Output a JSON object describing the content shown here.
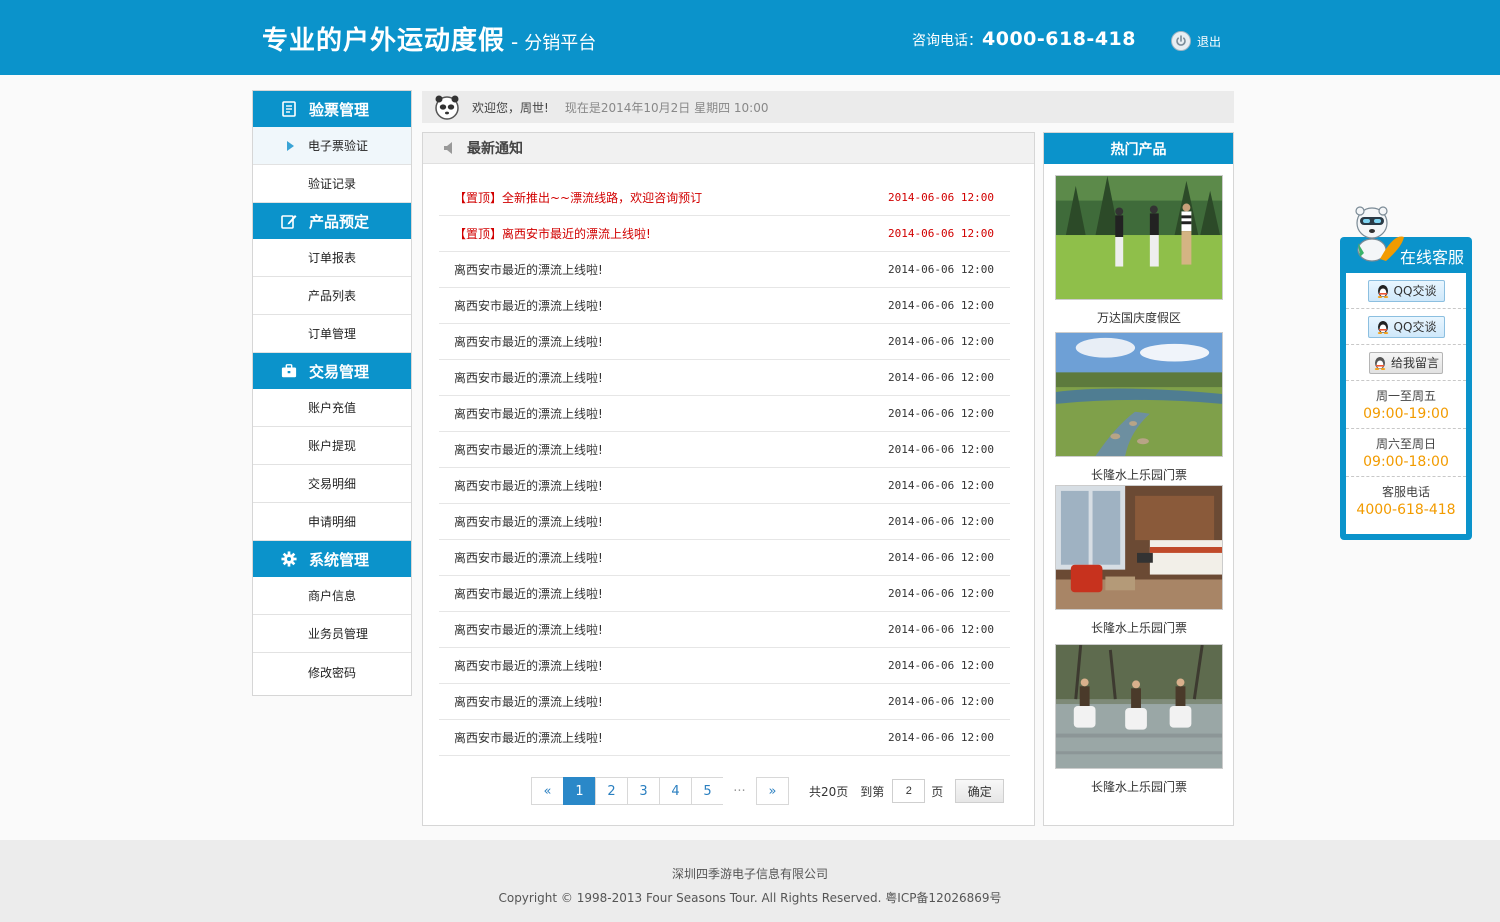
{
  "header": {
    "logo_main": "专业的户外运动度假",
    "logo_sep": "-",
    "logo_sub": "分销平台",
    "hotline_label": "咨询电话：",
    "hotline_number": "4000-618-418",
    "logout_label": "退出",
    "logout_icon": "power-icon"
  },
  "sidebar": {
    "groups": [
      {
        "title": "验票管理",
        "icon": "ticket-icon",
        "items": [
          "电子票验证",
          "验证记录"
        ]
      },
      {
        "title": "产品预定",
        "icon": "edit-icon",
        "items": [
          "订单报表",
          "产品列表",
          "订单管理"
        ]
      },
      {
        "title": "交易管理",
        "icon": "briefcase-icon",
        "items": [
          "账户充值",
          "账户提现",
          "交易明细",
          "申请明细"
        ]
      },
      {
        "title": "系统管理",
        "icon": "gear-icon",
        "items": [
          "商户信息",
          "业务员管理",
          "修改密码"
        ]
      }
    ],
    "active_item": "电子票验证"
  },
  "welcome": {
    "greeting": "欢迎您，周世!",
    "date_text": "现在是2014年10月2日 星期四 10:00"
  },
  "notice": {
    "title": "最新通知",
    "rows": [
      {
        "title": "【置顶】全新推出~~漂流线路，欢迎咨询预订",
        "date": "2014-06-06 12:00",
        "pinned": true
      },
      {
        "title": "【置顶】离西安市最近的漂流上线啦!",
        "date": "2014-06-06 12:00",
        "pinned": true
      },
      {
        "title": "离西安市最近的漂流上线啦!",
        "date": "2014-06-06 12:00",
        "pinned": false
      },
      {
        "title": "离西安市最近的漂流上线啦!",
        "date": "2014-06-06 12:00",
        "pinned": false
      },
      {
        "title": "离西安市最近的漂流上线啦!",
        "date": "2014-06-06 12:00",
        "pinned": false
      },
      {
        "title": "离西安市最近的漂流上线啦!",
        "date": "2014-06-06 12:00",
        "pinned": false
      },
      {
        "title": "离西安市最近的漂流上线啦!",
        "date": "2014-06-06 12:00",
        "pinned": false
      },
      {
        "title": "离西安市最近的漂流上线啦!",
        "date": "2014-06-06 12:00",
        "pinned": false
      },
      {
        "title": "离西安市最近的漂流上线啦!",
        "date": "2014-06-06 12:00",
        "pinned": false
      },
      {
        "title": "离西安市最近的漂流上线啦!",
        "date": "2014-06-06 12:00",
        "pinned": false
      },
      {
        "title": "离西安市最近的漂流上线啦!",
        "date": "2014-06-06 12:00",
        "pinned": false
      },
      {
        "title": "离西安市最近的漂流上线啦!",
        "date": "2014-06-06 12:00",
        "pinned": false
      },
      {
        "title": "离西安市最近的漂流上线啦!",
        "date": "2014-06-06 12:00",
        "pinned": false
      },
      {
        "title": "离西安市最近的漂流上线啦!",
        "date": "2014-06-06 12:00",
        "pinned": false
      },
      {
        "title": "离西安市最近的漂流上线啦!",
        "date": "2014-06-06 12:00",
        "pinned": false
      },
      {
        "title": "离西安市最近的漂流上线啦!",
        "date": "2014-06-06 12:00",
        "pinned": false
      }
    ]
  },
  "pager": {
    "prev": "«",
    "pages": [
      "1",
      "2",
      "3",
      "4",
      "5"
    ],
    "current": "1",
    "ellipsis": "···",
    "next": "»",
    "total": "共20页",
    "goto_label": "到第",
    "goto_value": "2",
    "unit": "页",
    "confirm": "确定"
  },
  "hot": {
    "title": "热门产品",
    "products": [
      {
        "caption": "万达国庆度假区",
        "scene": "horse-riders-on-lawn"
      },
      {
        "caption": "长隆水上乐园门票",
        "scene": "golf-course-stream"
      },
      {
        "caption": "长隆水上乐园门票",
        "scene": "hotel-room"
      },
      {
        "caption": "长隆水上乐园门票",
        "scene": "horses-crossing-river"
      }
    ]
  },
  "service": {
    "title": "在线客服",
    "buttons": [
      "QQ交谈",
      "QQ交谈",
      "给我留言"
    ],
    "hours": [
      {
        "label": "周一至周五",
        "value": "09:00-19:00"
      },
      {
        "label": "周六至周日",
        "value": "09:00-18:00"
      },
      {
        "label": "客服电话",
        "value": "4000-618-418"
      }
    ],
    "accent_color": "#f29b00"
  },
  "footer": {
    "company": "深圳四季游电子信息有限公司",
    "copyright": "Copyright © 1998-2013 Four Seasons Tour. All Rights Reserved. 粤ICP备12026869号"
  },
  "colors": {
    "brand": "#0b93cb",
    "pinned_red": "#d10000",
    "pager_active": "#2a88c8"
  }
}
